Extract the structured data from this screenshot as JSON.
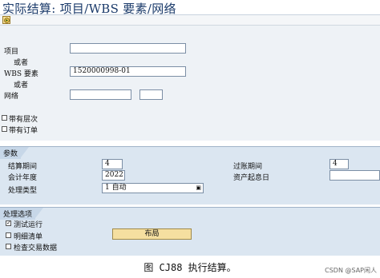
{
  "window": {
    "title": "实际结算: 项目/WBS 要素/网络"
  },
  "toolbar": {
    "execute_icon": "execute-icon"
  },
  "selection": {
    "project_label": "项目",
    "project_value": "",
    "or_label_1": "或者",
    "wbs_label": "WBS 要素",
    "wbs_value": "1520000998-01",
    "or_label_2": "或者",
    "network_label": "网络",
    "network_value": "",
    "network_value_2": "",
    "with_hierarchy_label": "带有层次",
    "with_orders_label": "带有订单"
  },
  "parameters": {
    "title": "参数",
    "settlement_period_label": "结算期间",
    "settlement_period_value": "4",
    "posting_period_label": "过账期间",
    "posting_period_value": "4",
    "fiscal_year_label": "会计年度",
    "fiscal_year_value": "2022",
    "asset_value_date_label": "资产起息日",
    "asset_value_date_value": "",
    "processing_type_label": "处理类型",
    "processing_type_value": "1 自动"
  },
  "processing": {
    "title": "处理选项",
    "test_run_label": "测试运行",
    "test_run_checked": true,
    "detail_list_label": "明细清单",
    "detail_list_checked": false,
    "check_trans_label": "检查交易数据",
    "check_trans_checked": false,
    "layout_button": "布局"
  },
  "caption": "图 CJ88 执行结算。",
  "watermark": "CSDN @SAP闲人"
}
